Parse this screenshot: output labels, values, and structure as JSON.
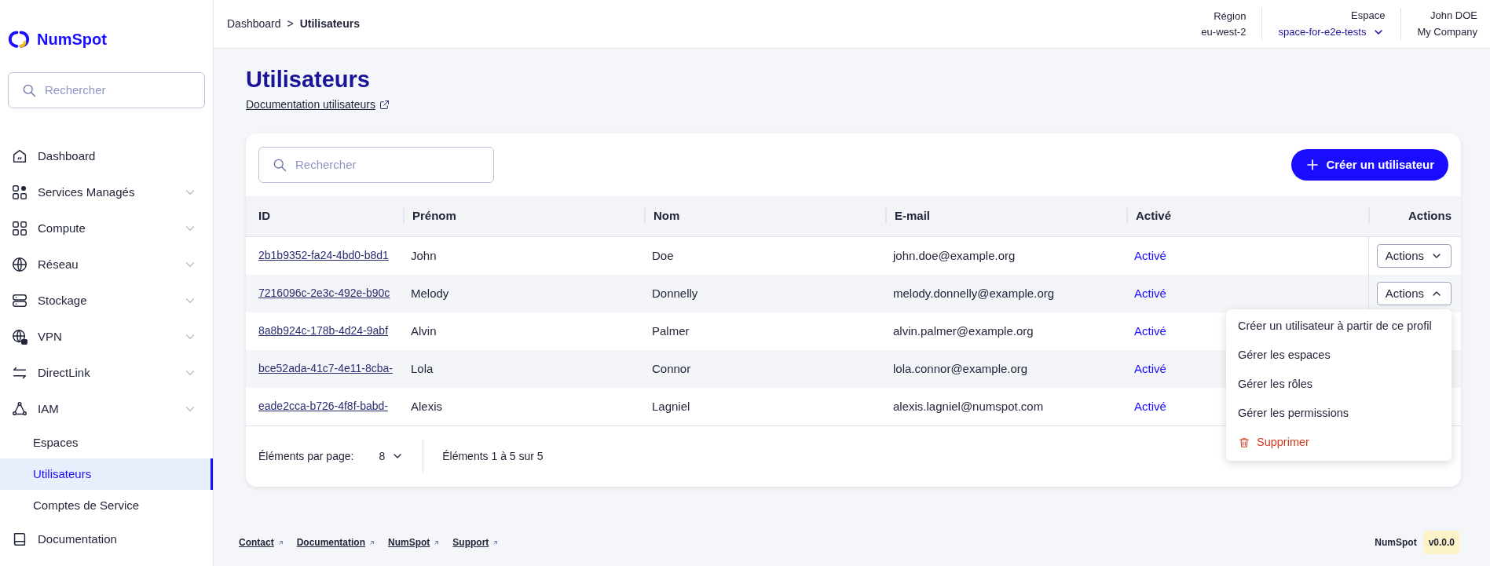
{
  "brand": {
    "name": "NumSpot"
  },
  "sidebar": {
    "search": {
      "placeholder": "Rechercher"
    },
    "items": [
      {
        "label": "Dashboard",
        "kind": "link"
      },
      {
        "label": "Services Managés",
        "kind": "group"
      },
      {
        "label": "Compute",
        "kind": "group"
      },
      {
        "label": "Réseau",
        "kind": "group"
      },
      {
        "label": "Stockage",
        "kind": "group"
      },
      {
        "label": "VPN",
        "kind": "group"
      },
      {
        "label": "DirectLink",
        "kind": "group"
      },
      {
        "label": "IAM",
        "kind": "group",
        "children": [
          {
            "label": "Espaces",
            "selected": false
          },
          {
            "label": "Utilisateurs",
            "selected": true
          },
          {
            "label": "Comptes de Service",
            "selected": false
          }
        ]
      },
      {
        "label": "Documentation",
        "kind": "link"
      }
    ]
  },
  "header": {
    "breadcrumb": [
      {
        "label": "Dashboard",
        "current": false
      },
      {
        "separator": ">"
      },
      {
        "label": "Utilisateurs",
        "current": true
      }
    ],
    "region": {
      "label": "Région",
      "value": "eu-west-2"
    },
    "space": {
      "label": "Espace",
      "value": "space-for-e2e-tests"
    },
    "user": {
      "name": "John DOE",
      "company": "My Company"
    }
  },
  "page": {
    "title": "Utilisateurs",
    "doc_link": "Documentation utilisateurs"
  },
  "table": {
    "search": {
      "placeholder": "Rechercher"
    },
    "create_button": "Créer un utilisateur",
    "columns": [
      "ID",
      "Prénom",
      "Nom",
      "E-mail",
      "Activé",
      "Actions"
    ],
    "rows": [
      {
        "id": "2b1b9352-fa24-4bd0-b8d1",
        "first": "John",
        "last": "Doe",
        "email": "john.doe@example.org",
        "status": "Activé",
        "actions": "Actions",
        "menu_open": false
      },
      {
        "id": "7216096c-2e3c-492e-b90c",
        "first": "Melody",
        "last": "Donnelly",
        "email": "melody.donnelly@example.org",
        "status": "Activé",
        "actions": "Actions",
        "menu_open": true
      },
      {
        "id": "8a8b924c-178b-4d24-9abf",
        "first": "Alvin",
        "last": "Palmer",
        "email": "alvin.palmer@example.org",
        "status": "Activé"
      },
      {
        "id": "bce52ada-41c7-4e11-8cba-",
        "first": "Lola",
        "last": "Connor",
        "email": "lola.connor@example.org",
        "status": "Activé"
      },
      {
        "id": "eade2cca-b726-4f8f-babd-",
        "first": "Alexis",
        "last": "Lagniel",
        "email": "alexis.lagniel@numspot.com",
        "status": "Activé"
      }
    ],
    "action_menu": [
      {
        "label": "Créer un utilisateur à partir de ce profil",
        "kind": "normal"
      },
      {
        "label": "Gérer les espaces",
        "kind": "normal"
      },
      {
        "label": "Gérer les rôles",
        "kind": "normal"
      },
      {
        "label": "Gérer les permissions",
        "kind": "normal"
      },
      {
        "label": "Supprimer",
        "kind": "danger"
      }
    ],
    "per_page": {
      "label": "Éléments par page:",
      "value": "8"
    },
    "range": "Éléments 1 à 5 sur 5"
  },
  "footer": {
    "links": [
      "Contact",
      "Documentation",
      "NumSpot",
      "Support"
    ],
    "brand": "NumSpot",
    "version": "v0.0.0"
  }
}
